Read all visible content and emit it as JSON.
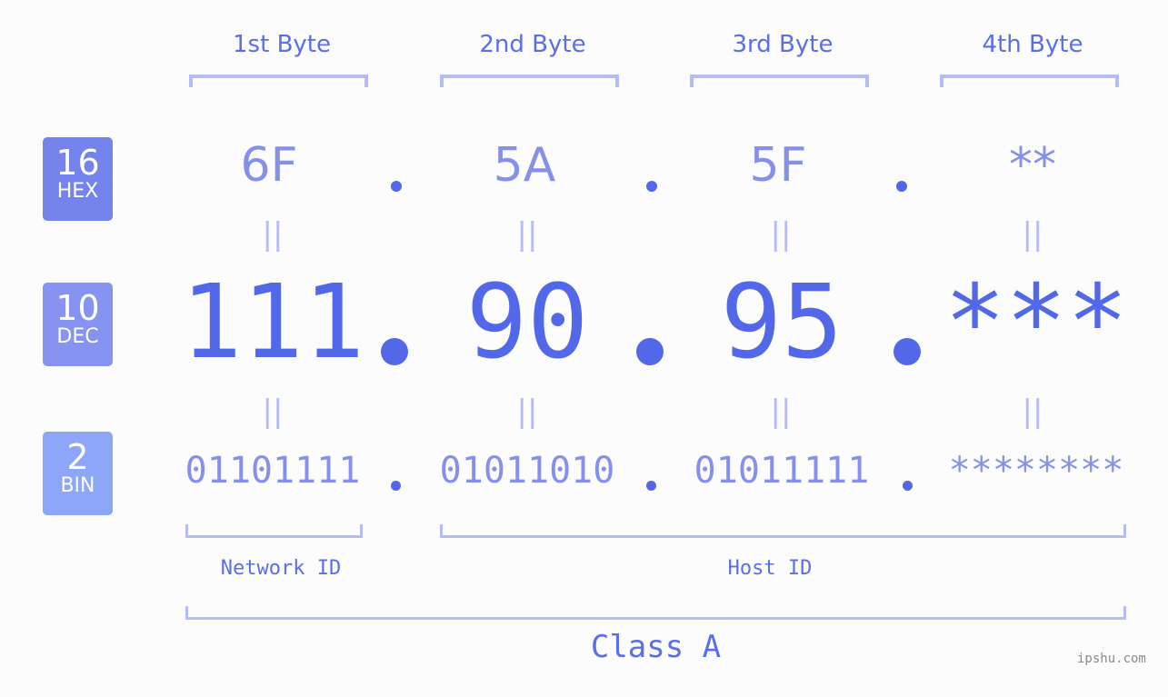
{
  "byte_headers": [
    "1st Byte",
    "2nd Byte",
    "3rd Byte",
    "4th Byte"
  ],
  "badges": {
    "hex": {
      "num": "16",
      "label": "HEX",
      "color": "#7583ec"
    },
    "dec": {
      "num": "10",
      "label": "DEC",
      "color": "#8693f0"
    },
    "bin": {
      "num": "2",
      "label": "BIN",
      "color": "#8ea6f8"
    }
  },
  "hex_values": [
    "6F",
    "5A",
    "5F",
    "**"
  ],
  "dec_values": [
    "111",
    "90",
    "95",
    "***"
  ],
  "bin_values": [
    "01101111",
    "01011010",
    "01011111",
    "********"
  ],
  "equals_sign": "||",
  "segments": {
    "network_id": "Network ID",
    "host_id": "Host ID",
    "class": "Class A"
  },
  "watermark": "ipshu.com",
  "colors": {
    "primary": "#5368e8",
    "light": "#8490ec",
    "bracket": "#b4bcf8",
    "background": "#fbfcfb"
  }
}
